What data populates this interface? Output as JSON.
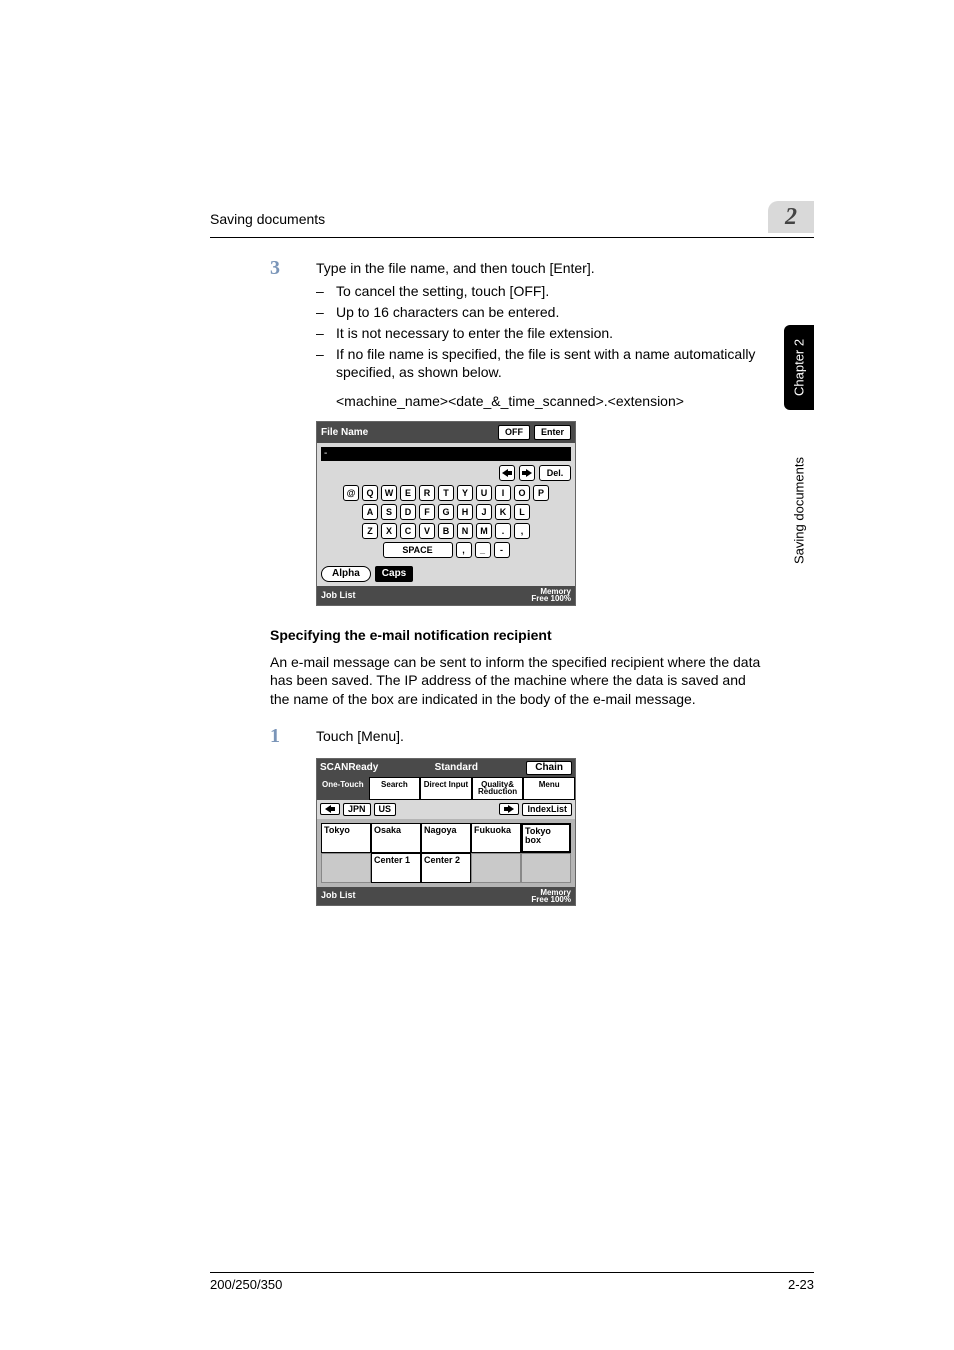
{
  "header": {
    "title": "Saving documents",
    "chapter_glyph": "2"
  },
  "side": {
    "dark": "Chapter 2",
    "light": "Saving documents"
  },
  "step3": {
    "num": "3",
    "text": "Type in the file name, and then touch [Enter].",
    "bullets": [
      "To cancel the setting, touch [OFF].",
      "Up to 16 characters can be entered.",
      "It is not necessary to enter the file extension.",
      "If no file name is specified, the file is sent with a name automatically specified, as shown below."
    ],
    "format_line": "<machine_name><date_&_time_scanned>.<extension>"
  },
  "panel1": {
    "title": "File Name",
    "off": "OFF",
    "enter": "Enter",
    "del": "Del.",
    "cursor": "-",
    "row1": [
      "@",
      "Q",
      "W",
      "E",
      "R",
      "T",
      "Y",
      "U",
      "I",
      "O",
      "P"
    ],
    "row2": [
      "A",
      "S",
      "D",
      "F",
      "G",
      "H",
      "J",
      "K",
      "L"
    ],
    "row3": [
      "Z",
      "X",
      "C",
      "V",
      "B",
      "N",
      "M",
      ".",
      ","
    ],
    "space": "SPACE",
    "punct1": ",",
    "punct2": "_",
    "punct3": "-",
    "alpha": "Alpha",
    "caps": "Caps",
    "joblist": "Job List",
    "mem1": "Memory",
    "mem2": "Free",
    "mem3": "100%"
  },
  "section": {
    "heading": "Specifying the e-mail notification recipient",
    "para": "An e-mail message can be sent to inform the specified recipient where the data has been saved. The IP address of the machine where the data is saved and the name of the box are indicated in the body of the e-mail message."
  },
  "step1": {
    "num": "1",
    "text": "Touch [Menu]."
  },
  "panel2": {
    "ready": "SCANReady",
    "standard": "Standard",
    "chain": "Chain",
    "tabs": {
      "onetouch": "One-Touch",
      "search": "Search",
      "direct": "Direct Input",
      "quality": "Quality& Reduction",
      "menu": "Menu"
    },
    "nav": {
      "left_arrow": "←",
      "jpn": "JPN",
      "us": "US",
      "right_arrow": "→",
      "indexlist": "IndexList"
    },
    "cells": {
      "r1": [
        "Tokyo",
        "Osaka",
        "Nagoya",
        "Fukuoka",
        "Tokyo box"
      ],
      "r2": [
        "",
        "Center 1",
        "Center 2",
        "",
        ""
      ]
    },
    "joblist": "Job List",
    "mem1": "Memory",
    "mem2": "Free",
    "mem3": "100%"
  },
  "footer": {
    "left": "200/250/350",
    "right": "2-23"
  }
}
